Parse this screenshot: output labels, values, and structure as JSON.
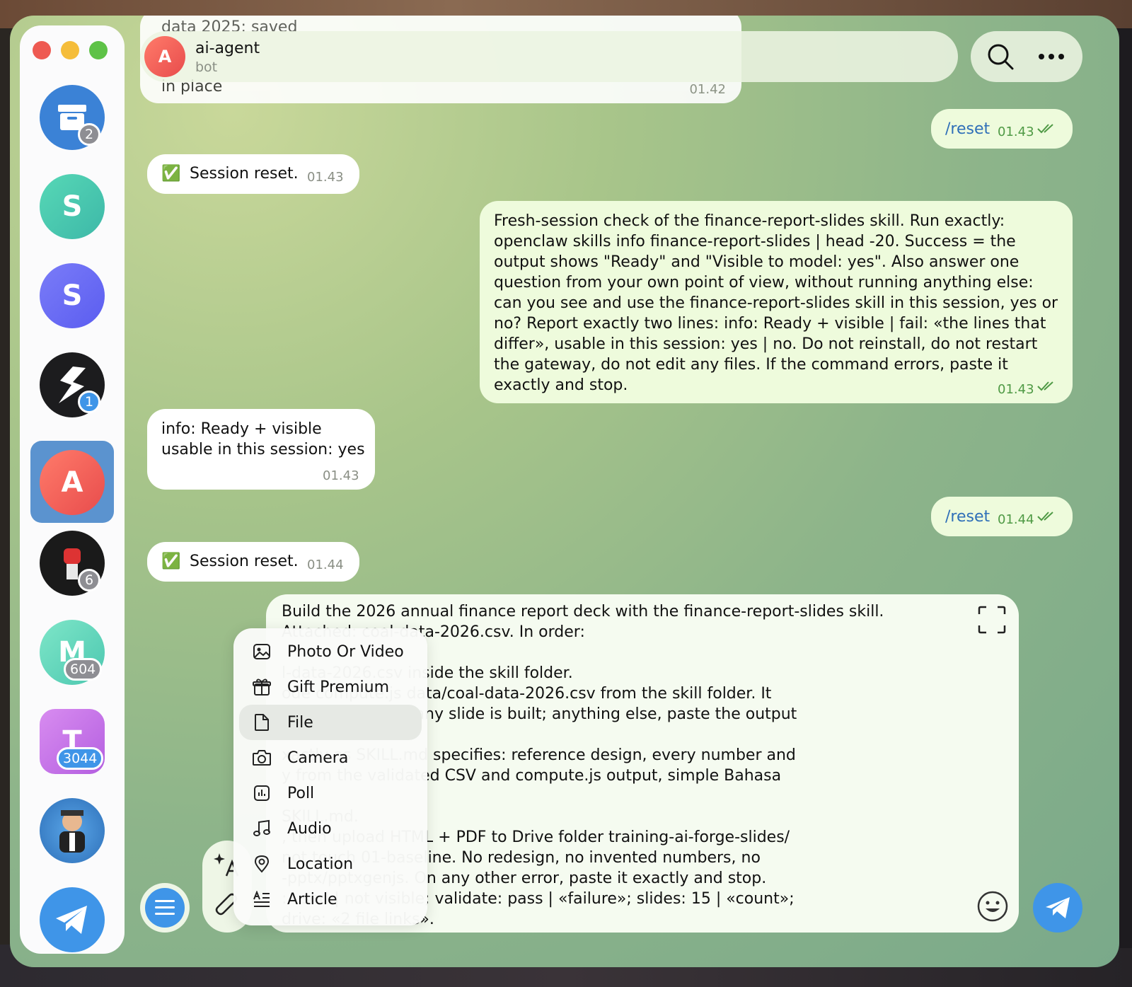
{
  "chat": {
    "name": "ai-agent",
    "subtitle": "bot",
    "avatar_letter": "A",
    "faded_line_top": "data 2025: saved",
    "faded_line_bottom": "in place",
    "faded_time": "01.42"
  },
  "sidebar": {
    "items": [
      {
        "letter": "",
        "badge": "2"
      },
      {
        "letter": "S",
        "badge": ""
      },
      {
        "letter": "S",
        "badge": ""
      },
      {
        "letter": "",
        "badge": "1"
      },
      {
        "letter": "A",
        "badge": ""
      },
      {
        "letter": "",
        "badge": "6"
      },
      {
        "letter": "M",
        "badge": "604"
      },
      {
        "letter": "T",
        "badge": "3044"
      },
      {
        "letter": "",
        "badge": ""
      },
      {
        "letter": "",
        "badge": ""
      }
    ]
  },
  "messages": {
    "m1": {
      "text": "/reset",
      "time": "01.43"
    },
    "m2": {
      "emoji": "✅",
      "text": "Session reset.",
      "time": "01.43"
    },
    "m3": {
      "text": "Fresh-session check of the finance-report-slides skill. Run exactly: openclaw skills info finance-report-slides | head -20. Success = the output shows \"Ready\" and \"Visible to model: yes\". Also answer one question from your own point of view, without running anything else: can you see and use the finance-report-slides skill in this session, yes or no? Report exactly two lines: info: Ready + visible | fail: «the lines that differ», usable in this session: yes | no. Do not reinstall, do not restart the gateway, do not edit any files. If the command errors, paste it exactly and stop.",
      "time": "01.43"
    },
    "m4": {
      "line1": "info: Ready + visible",
      "line2": "usable in this session: yes",
      "time": "01.43"
    },
    "m5": {
      "text": "/reset",
      "time": "01.44"
    },
    "m6": {
      "emoji": "✅",
      "text": "Session reset.",
      "time": "01.44"
    }
  },
  "composer": {
    "lines": [
      "Build the 2026 annual finance report deck with the finance-report-slides skill.",
      "Attached: coal-data-2026.csv. In order:",
      "",
      "l-data-2026.csv inside the skill folder.",
      "ode compute.js data/coal-data-2026.csv from the skill folder. It",
      "cks pass\" before any slide is built; anything else, paste the output",
      "uild.",
      "xactly as SKILL.md specifies: reference design, every number and",
      "y from the validated CSV and compute.js output, simple Bahasa",
      "",
      "SKILL.md.",
      ", then upload HTML + PDF to Drive folder training-ai-forge-slides/",
      "not touch 01-baseline. No redesign, no invented numbers, no",
      "-pptx/pptxgenjs. On any other error, paste it exactly and stop.",
      ": used | not visible; validate: pass | «failure»; slides: 15 | «count»;",
      "drive: «2 file links»."
    ]
  },
  "attach_menu": {
    "items": [
      {
        "label": "Photo Or Video",
        "icon": "photo-icon"
      },
      {
        "label": "Gift Premium",
        "icon": "gift-icon"
      },
      {
        "label": "File",
        "icon": "file-icon"
      },
      {
        "label": "Camera",
        "icon": "camera-icon"
      },
      {
        "label": "Poll",
        "icon": "poll-icon"
      },
      {
        "label": "Audio",
        "icon": "audio-icon"
      },
      {
        "label": "Location",
        "icon": "location-icon"
      },
      {
        "label": "Article",
        "icon": "article-icon"
      }
    ],
    "highlighted": "File"
  },
  "colors": {
    "accent": "#3f95e8",
    "outgoing_bubble": "#eefbdc",
    "incoming_bubble": "#ffffff",
    "outgoing_time": "#4f9a45"
  }
}
